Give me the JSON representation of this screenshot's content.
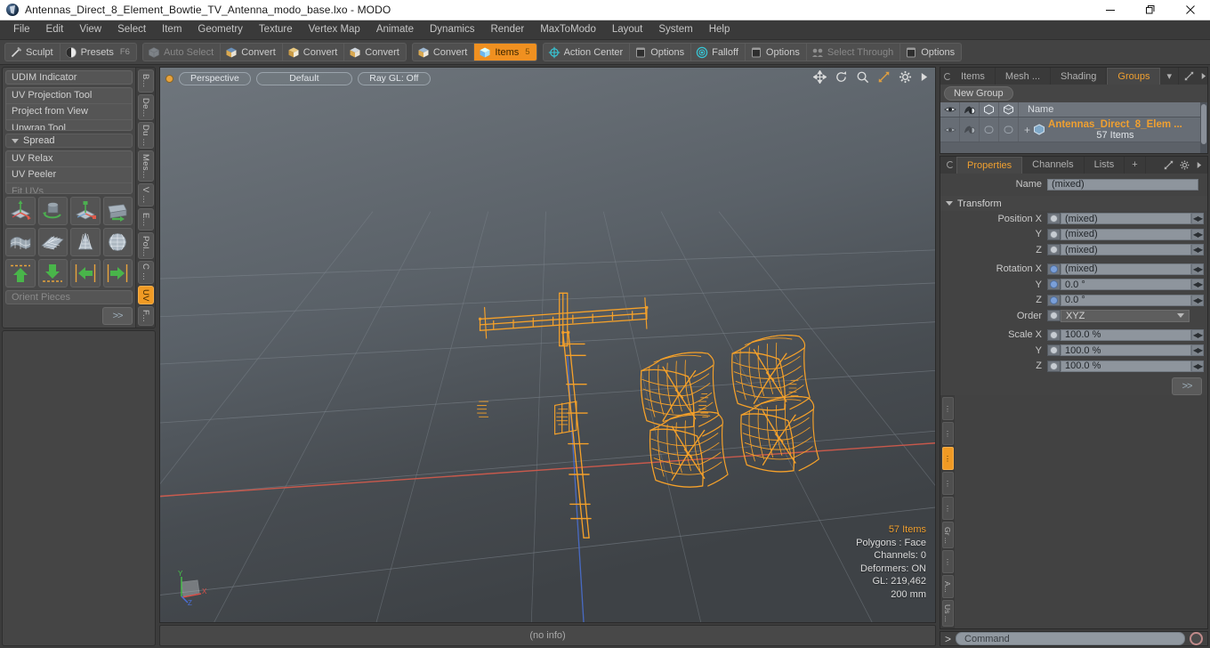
{
  "window": {
    "title": "Antennas_Direct_8_Element_Bowtie_TV_Antenna_modo_base.lxo - MODO",
    "minimize": "—",
    "maximize": "❐",
    "close": "✕"
  },
  "menubar": {
    "items": [
      "File",
      "Edit",
      "View",
      "Select",
      "Item",
      "Geometry",
      "Texture",
      "Vertex Map",
      "Animate",
      "Dynamics",
      "Render",
      "MaxToModo",
      "Layout",
      "System",
      "Help"
    ]
  },
  "toolbar": {
    "group1": [
      {
        "label": "Sculpt",
        "icon": "brush-icon",
        "state": "normal",
        "shortcut": ""
      },
      {
        "label": "Presets",
        "icon": "sphere-icon",
        "state": "normal",
        "shortcut": "F6"
      }
    ],
    "group2": [
      {
        "label": "Auto Select",
        "icon": "cube-icon",
        "state": "disabled",
        "shortcut": ""
      },
      {
        "label": "Convert",
        "icon": "cube-icon",
        "state": "normal",
        "shortcut": ""
      },
      {
        "label": "Convert",
        "icon": "cube-icon",
        "state": "normal",
        "shortcut": ""
      },
      {
        "label": "Convert",
        "icon": "cube-icon",
        "state": "normal",
        "shortcut": ""
      }
    ],
    "group3": [
      {
        "label": "Convert",
        "icon": "cube-icon",
        "state": "normal",
        "shortcut": ""
      },
      {
        "label": "Items",
        "icon": "cube-icon",
        "state": "active",
        "shortcut": "5"
      }
    ],
    "group4": [
      {
        "label": "Action Center",
        "icon": "crosshair-icon",
        "state": "normal",
        "shortcut": ""
      },
      {
        "label": "Options",
        "icon": "panel-icon",
        "state": "normal",
        "shortcut": ""
      },
      {
        "label": "Falloff",
        "icon": "target-icon",
        "state": "normal",
        "shortcut": ""
      },
      {
        "label": "Options",
        "icon": "panel-icon",
        "state": "normal",
        "shortcut": ""
      },
      {
        "label": "Select Through",
        "icon": "through-icon",
        "state": "disabled",
        "shortcut": ""
      },
      {
        "label": "Options",
        "icon": "panel-icon",
        "state": "normal",
        "shortcut": ""
      }
    ]
  },
  "left_panel": {
    "udim": "UDIM Indicator",
    "tools_group_a": [
      "UV Projection Tool",
      "Project from View",
      "Unwrap Tool"
    ],
    "spread_header": "Spread",
    "tools_group_b": [
      {
        "label": "UV Relax",
        "disabled": false
      },
      {
        "label": "UV Peeler",
        "disabled": false
      },
      {
        "label": "Fit UVs",
        "disabled": true
      }
    ],
    "icon_row_1": [
      "move-uv-icon",
      "rotate-uv-icon",
      "scale-uv-icon",
      "flip-uv-icon"
    ],
    "icon_row_2": [
      "drape-icon",
      "grid-unwrap-icon",
      "cone-unwrap-icon",
      "sphere-unwrap-icon"
    ],
    "icon_row_3": [
      "align-up-icon",
      "align-down-icon",
      "align-left-icon",
      "align-right-icon"
    ],
    "orient": "Orient Pieces",
    "more_button": ">>",
    "vtabs": [
      {
        "label": "B...",
        "active": false
      },
      {
        "label": "De...",
        "active": false
      },
      {
        "label": "Du ...",
        "active": false
      },
      {
        "label": "Mes...",
        "active": false
      },
      {
        "label": "V ...",
        "active": false
      },
      {
        "label": "E...",
        "active": false
      },
      {
        "label": "Pol...",
        "active": false
      },
      {
        "label": "C ...",
        "active": false
      },
      {
        "label": "UV",
        "active": true
      },
      {
        "label": "F...",
        "active": false
      }
    ]
  },
  "viewport": {
    "pills": [
      "Perspective",
      "Default",
      "Ray GL: Off"
    ],
    "icons": [
      "pan-icon",
      "rotate-icon",
      "zoom-icon",
      "fit-icon",
      "gear-icon",
      "play-icon"
    ],
    "info": {
      "items": "57 Items",
      "polygons": "Polygons : Face",
      "channels": "Channels: 0",
      "deformers": "Deformers: ON",
      "gl": "GL: 219,462",
      "scale": "200 mm"
    },
    "axis": {
      "x": "X",
      "y": "Y",
      "z": "Z"
    }
  },
  "statusbar": {
    "text": "(no info)"
  },
  "right_panel": {
    "tabs": [
      {
        "label": "Items",
        "active": false
      },
      {
        "label": "Mesh ...",
        "active": false
      },
      {
        "label": "Shading",
        "active": false
      },
      {
        "label": "Groups",
        "active": true
      }
    ],
    "tab_overflow": "▾",
    "new_group_button": "New Group",
    "list_header": {
      "col_eye": "visibility-icon",
      "col_render": "render-icon",
      "col_lock1": "lock-icon",
      "col_lock2": "lock2-icon",
      "name": "Name"
    },
    "rows": [
      {
        "expand": "+",
        "title": "Antennas_Direct_8_Elem ...",
        "subtitle": "57 Items",
        "icon": "group-icon"
      }
    ]
  },
  "properties": {
    "tabs": [
      {
        "label": "Properties",
        "active": true
      },
      {
        "label": "Channels",
        "active": false
      },
      {
        "label": "Lists",
        "active": false
      },
      {
        "label": "+",
        "active": false
      }
    ],
    "name_label": "Name",
    "name_value": "(mixed)",
    "transform_header": "Transform",
    "fields": [
      {
        "label": "Position X",
        "value": "(mixed)",
        "radio": "grey"
      },
      {
        "label": "Y",
        "value": "(mixed)",
        "radio": "grey"
      },
      {
        "label": "Z",
        "value": "(mixed)",
        "radio": "grey"
      },
      {
        "label": "Rotation X",
        "value": "(mixed)",
        "radio": "blue"
      },
      {
        "label": "Y",
        "value": "0.0 °",
        "radio": "blue"
      },
      {
        "label": "Z",
        "value": "0.0 °",
        "radio": "blue"
      }
    ],
    "order_label": "Order",
    "order_value": "XYZ",
    "scale_fields": [
      {
        "label": "Scale X",
        "value": "100.0 %",
        "radio": "grey"
      },
      {
        "label": "Y",
        "value": "100.0 %",
        "radio": "grey"
      },
      {
        "label": "Z",
        "value": "100.0 %",
        "radio": "grey"
      }
    ],
    "more_button": ">>",
    "vtabs": [
      {
        "label": "",
        "active": false
      },
      {
        "label": "",
        "active": false
      },
      {
        "label": "",
        "active": true
      },
      {
        "label": "",
        "active": false
      },
      {
        "label": "",
        "active": false
      },
      {
        "label": "Gr ...",
        "active": false
      },
      {
        "label": "",
        "active": false
      },
      {
        "label": "A...",
        "active": false
      },
      {
        "label": "Us ...",
        "active": false
      }
    ]
  },
  "command_bar": {
    "prompt": ">",
    "placeholder": "Command",
    "record_button": "record-icon"
  },
  "colors": {
    "accent": "#f0a030",
    "mesh": "#f5a12a",
    "panel": "#434343",
    "field": "#8e959d"
  }
}
